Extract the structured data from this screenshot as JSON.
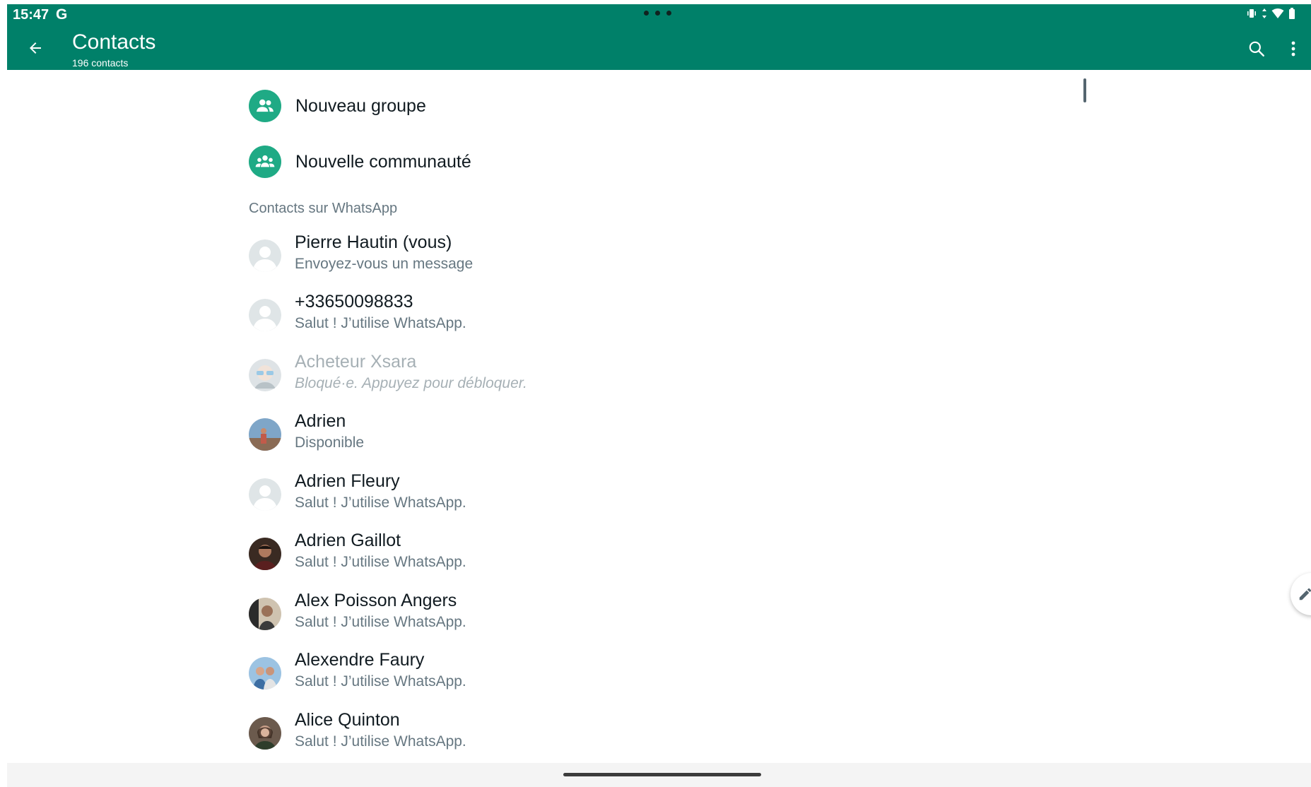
{
  "status_bar": {
    "time": "15:47",
    "carrier_letter": "G"
  },
  "app_bar": {
    "title": "Contacts",
    "subtitle": "196 contacts",
    "back_icon": "arrow-left-icon",
    "search_icon": "search-icon",
    "more_icon": "more-vert-icon",
    "background_color": "#008069"
  },
  "actions": [
    {
      "label": "Nouveau groupe",
      "icon": "group-icon"
    },
    {
      "label": "Nouvelle communauté",
      "icon": "community-icon"
    }
  ],
  "section_header": "Contacts sur WhatsApp",
  "contacts": [
    {
      "name": "Pierre Hautin (vous)",
      "status": "Envoyez-vous un message",
      "avatar": "default-avatar-icon",
      "blocked": false
    },
    {
      "name": "+33650098833",
      "status": "Salut ! J’utilise WhatsApp.",
      "avatar": "default-avatar-icon",
      "blocked": false
    },
    {
      "name": "Acheteur Xsara",
      "status": "Bloqué·e. Appuyez pour débloquer.",
      "avatar": "photo-avatar",
      "blocked": true
    },
    {
      "name": "Adrien",
      "status": "Disponible",
      "avatar": "photo-avatar",
      "blocked": false
    },
    {
      "name": "Adrien Fleury",
      "status": "Salut ! J’utilise WhatsApp.",
      "avatar": "default-avatar-icon",
      "blocked": false
    },
    {
      "name": "Adrien Gaillot",
      "status": "Salut ! J’utilise WhatsApp.",
      "avatar": "photo-avatar",
      "blocked": false
    },
    {
      "name": "Alex Poisson Angers",
      "status": "Salut ! J’utilise WhatsApp.",
      "avatar": "photo-avatar",
      "blocked": false
    },
    {
      "name": "Alexendre Faury",
      "status": "Salut ! J’utilise WhatsApp.",
      "avatar": "photo-avatar",
      "blocked": false
    },
    {
      "name": "Alice Quinton",
      "status": "Salut ! J’utilise WhatsApp.",
      "avatar": "photo-avatar",
      "blocked": false
    }
  ],
  "fab_icon": "edit-pencil-icon",
  "colors": {
    "accent": "#1faa85",
    "primary_text": "#111b21",
    "secondary_text": "#667781",
    "blocked_text": "#a6b0b5"
  }
}
